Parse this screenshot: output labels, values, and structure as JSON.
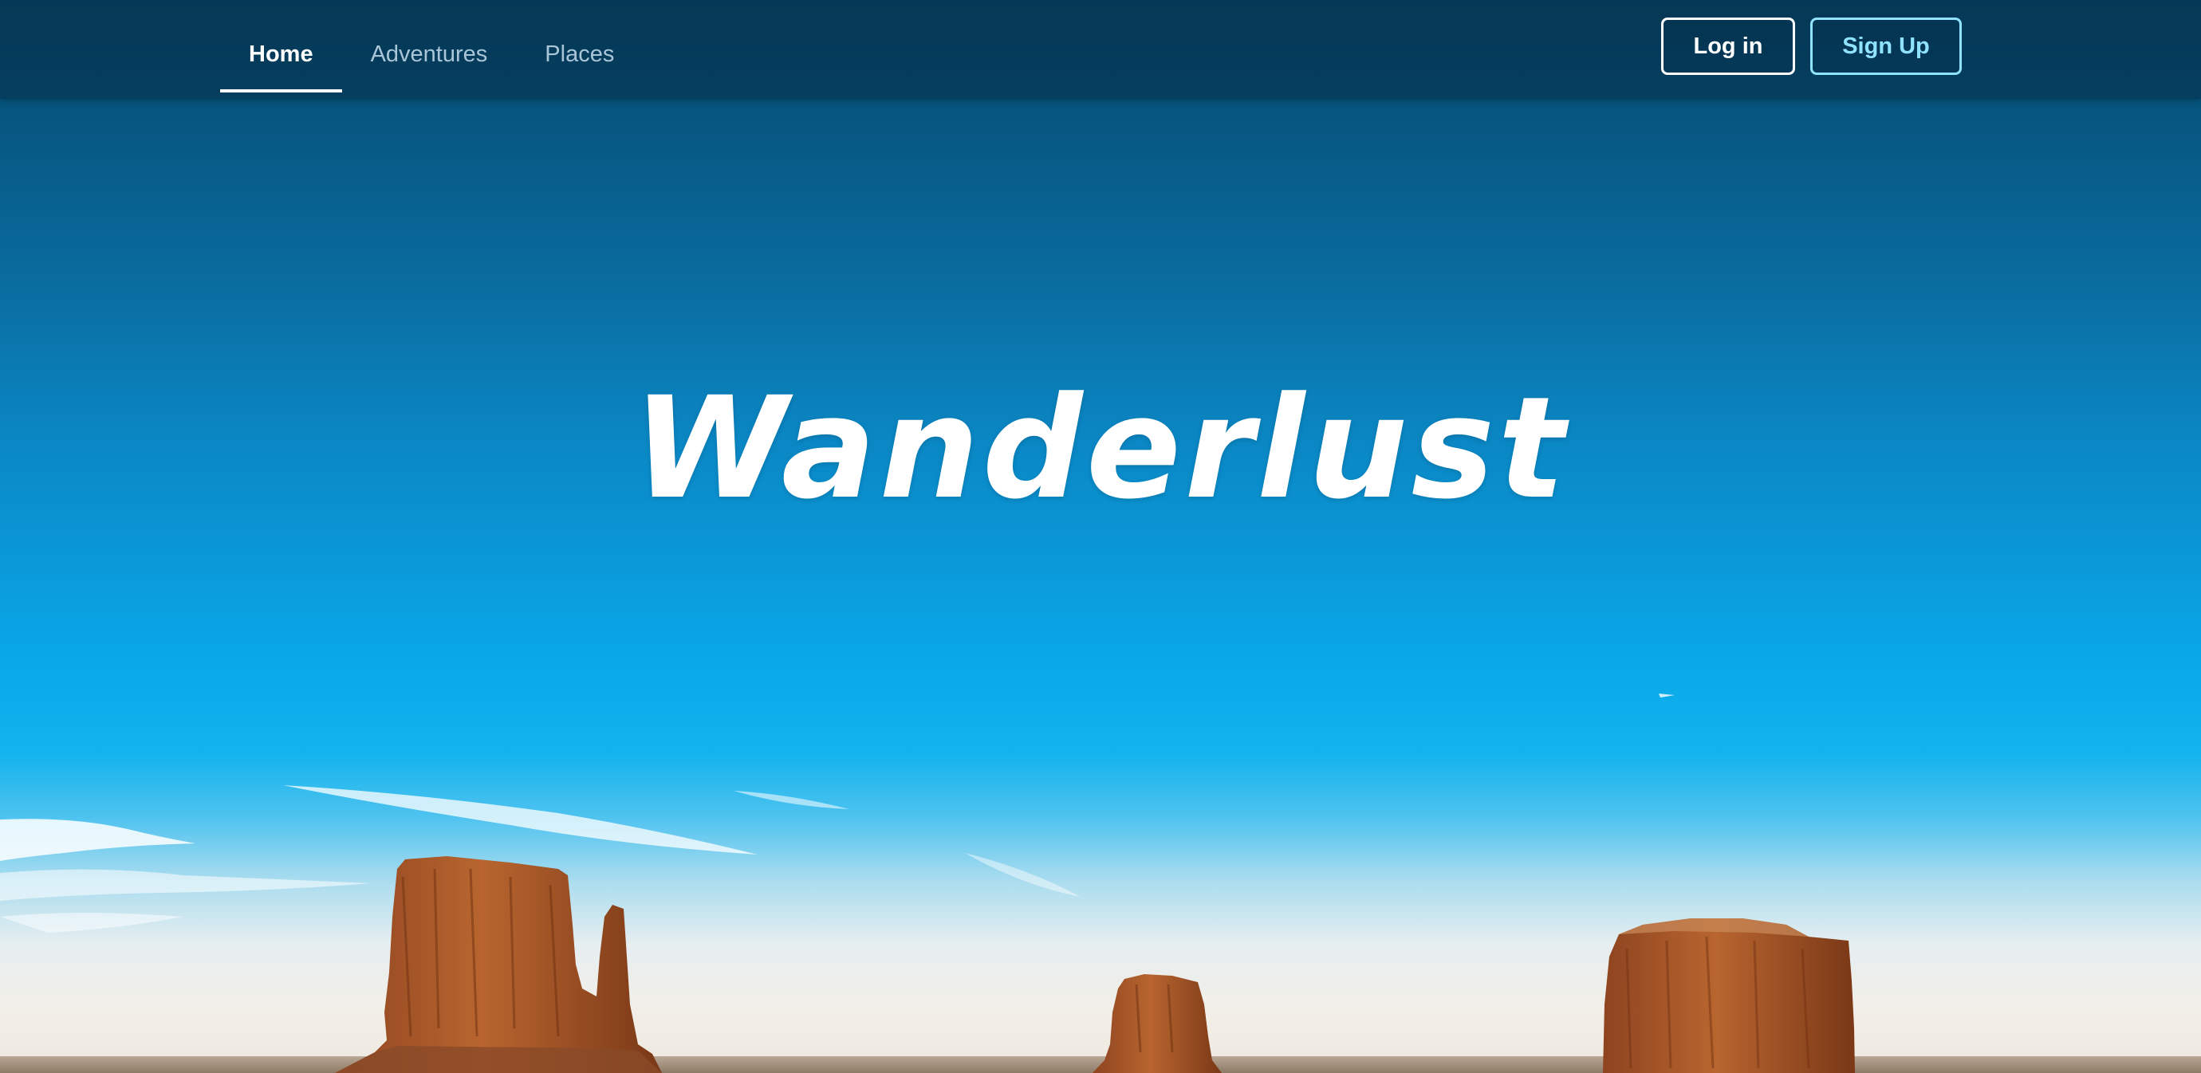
{
  "nav": {
    "links": [
      {
        "label": "Home",
        "active": true
      },
      {
        "label": "Adventures",
        "active": false
      },
      {
        "label": "Places",
        "active": false
      }
    ],
    "login_label": "Log in",
    "signup_label": "Sign Up"
  },
  "hero": {
    "title": "Wanderlust"
  },
  "colors": {
    "nav_background": "#05344f",
    "signup_accent": "#8fe3ff",
    "sky_top": "#05466a",
    "sky_mid": "#0a98d8",
    "rock": "#a4532a"
  }
}
